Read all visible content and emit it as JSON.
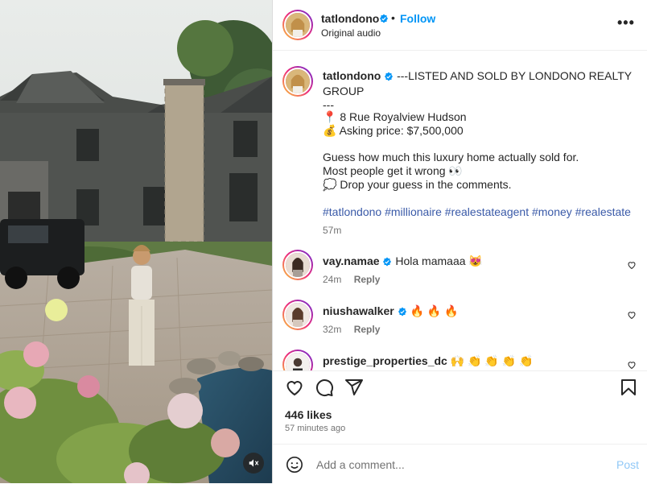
{
  "header": {
    "username": "tatlondono",
    "dot": "•",
    "follow_label": "Follow",
    "audio_label": "Original audio",
    "more_label": "•••"
  },
  "caption": {
    "username": "tatlondono",
    "line1": "---LISTED AND SOLD BY LONDONO REALTY GROUP",
    "line2": "---",
    "address_emoji": "📍",
    "address": "8 Rue Royalview Hudson",
    "price_emoji": "💰",
    "price": "Asking price: $7,500,000",
    "question": "Guess how much this luxury home actually sold for.",
    "wrong": "Most people get it wrong",
    "wrong_emoji": "👀",
    "drop_emoji": "💭",
    "drop": "Drop your guess in the comments.",
    "hashtags": [
      "#tatlondono",
      "#millionaire",
      "#realestateagent",
      "#money",
      "#realestate"
    ],
    "time": "57m"
  },
  "comments": [
    {
      "username": "vay.namae",
      "text": "Hola mamaaa",
      "emoji": "😻",
      "time": "24m",
      "reply": "Reply"
    },
    {
      "username": "niushawalker",
      "text": "",
      "emoji": "🔥 🔥 🔥",
      "time": "32m",
      "reply": "Reply"
    },
    {
      "username": "prestige_properties_dc",
      "text": "",
      "emoji": "🙌 👏 👏 👏 👏",
      "time": "",
      "reply": ""
    }
  ],
  "actions": {
    "likes": "446 likes",
    "time_ago": "57 minutes ago",
    "comment_placeholder": "Add a comment...",
    "post_label": "Post"
  },
  "colors": {
    "accent": "#0095f6",
    "hashtag": "#3a5aa8",
    "muted_text": "#737373",
    "post_disabled": "#90c8f7"
  },
  "icons": {
    "verified": "verified-badge-icon",
    "heart": "heart-icon",
    "comment": "comment-icon",
    "share": "share-icon",
    "save": "bookmark-icon",
    "emoji": "emoji-icon",
    "mute": "muted-speaker-icon"
  }
}
